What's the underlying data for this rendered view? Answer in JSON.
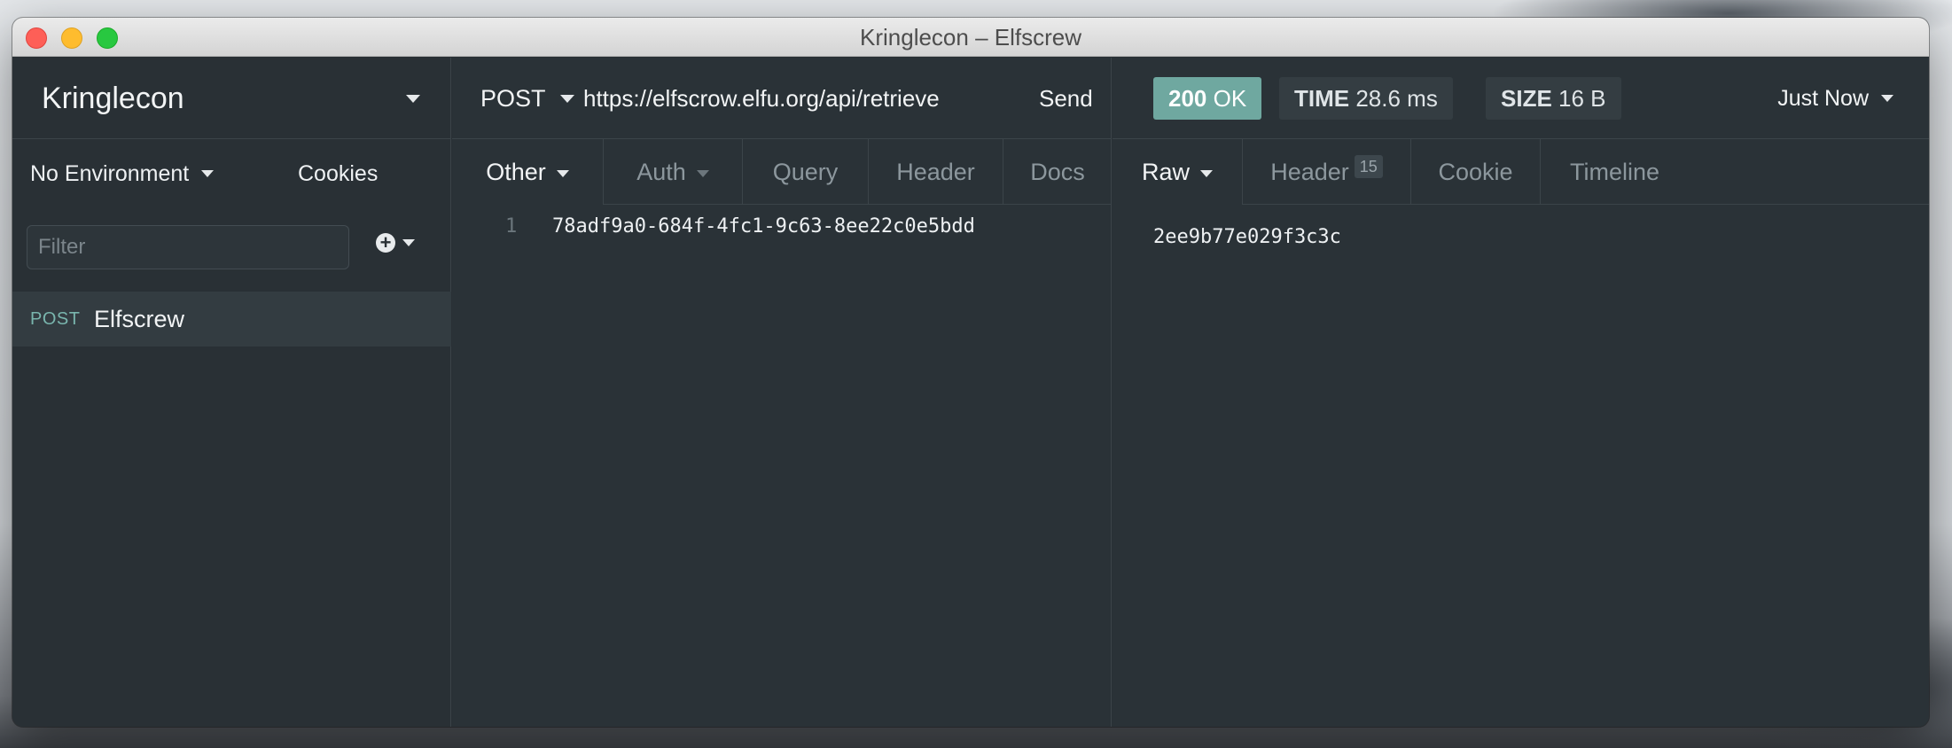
{
  "window": {
    "title": "Kringlecon – Elfscrew"
  },
  "sidebar": {
    "workspace": "Kringlecon",
    "environment": "No Environment",
    "cookies": "Cookies",
    "filter_placeholder": "Filter",
    "requests": [
      {
        "method": "POST",
        "name": "Elfscrew"
      }
    ]
  },
  "request": {
    "method": "POST",
    "url": "https://elfscrow.elfu.org/api/retrieve",
    "send_label": "Send",
    "tabs": [
      {
        "label": "Other"
      },
      {
        "label": "Auth"
      },
      {
        "label": "Query"
      },
      {
        "label": "Header"
      },
      {
        "label": "Docs"
      }
    ],
    "body": {
      "line_number": "1",
      "text": "78adf9a0-684f-4fc1-9c63-8ee22c0e5bdd"
    }
  },
  "response": {
    "status_code": "200",
    "status_text": "OK",
    "time_label": "TIME",
    "time_value": "28.6 ms",
    "size_label": "SIZE",
    "size_value": "16 B",
    "history_label": "Just Now",
    "tabs": [
      {
        "label": "Raw"
      },
      {
        "label": "Header",
        "count": "15"
      },
      {
        "label": "Cookie"
      },
      {
        "label": "Timeline"
      }
    ],
    "body": "2ee9b77e029f3c3c"
  },
  "colors": {
    "status_ok": "#6fa8a0",
    "method_post": "#79b5ad",
    "pane_background": "#2a3237"
  }
}
